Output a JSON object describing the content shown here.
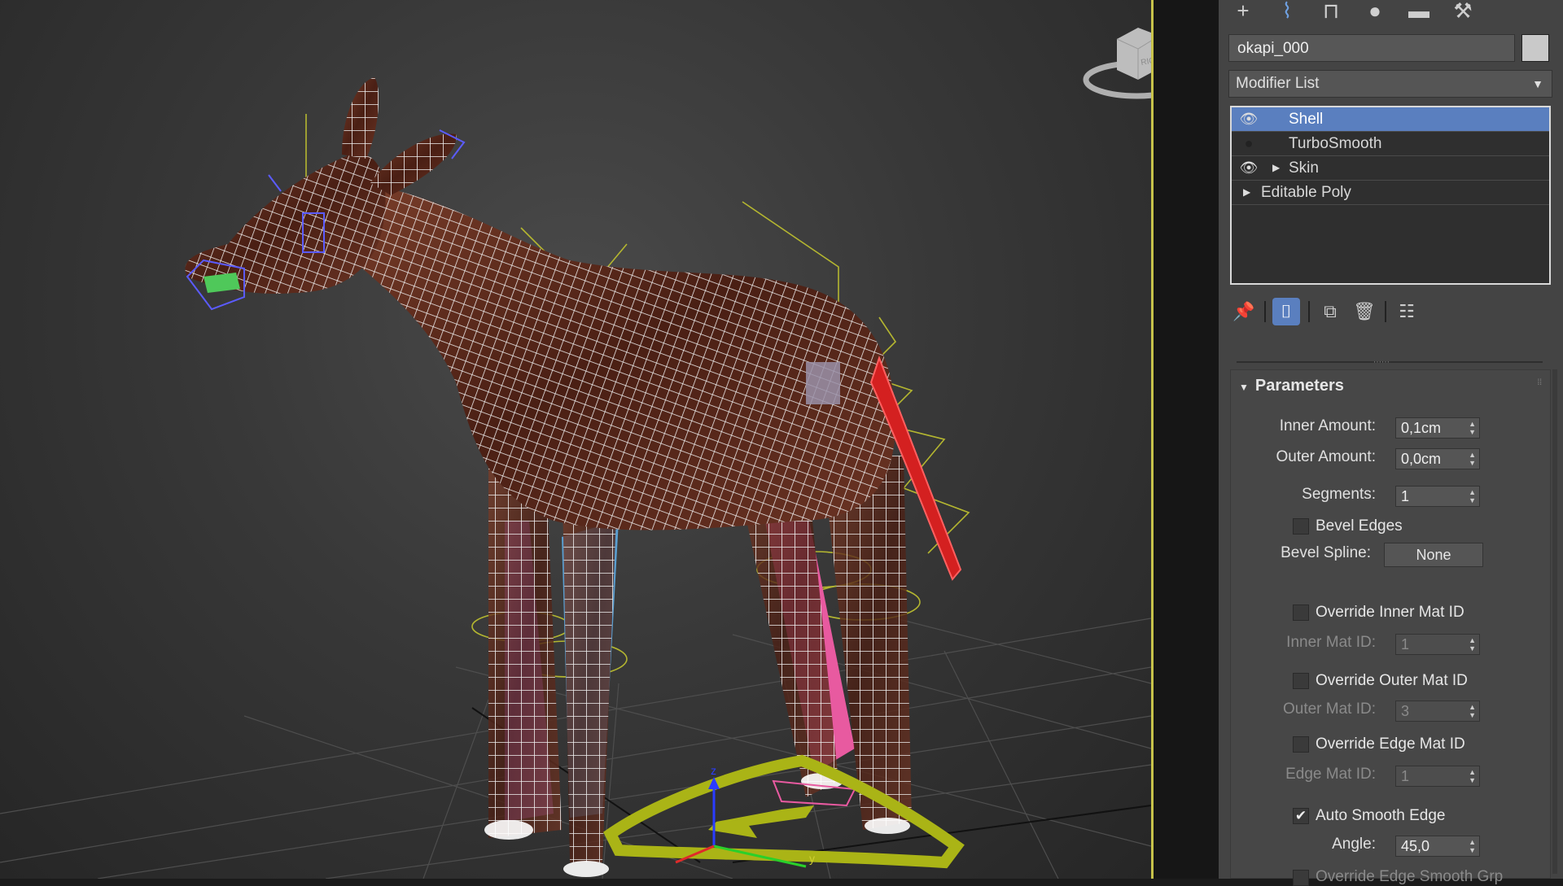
{
  "panel": {
    "top_icons": [
      "create-icon",
      "modify-icon",
      "hierarchy-icon",
      "motion-icon",
      "display-icon",
      "utilities-icon"
    ],
    "object_name": "okapi_000",
    "object_color": "#c9c9c9",
    "modifier_list_label": "Modifier List",
    "stack": [
      {
        "label": "Shell",
        "visible": true,
        "selected": true
      },
      {
        "label": "TurboSmooth",
        "visible": false,
        "selected": false
      },
      {
        "label": "Skin",
        "visible": true,
        "selected": false,
        "expandable": true
      },
      {
        "label": "Editable Poly",
        "base": true,
        "expandable": true
      }
    ],
    "rollout_title": "Parameters",
    "inner_amount_label": "Inner Amount:",
    "inner_amount_value": "0,1cm",
    "outer_amount_label": "Outer Amount:",
    "outer_amount_value": "0,0cm",
    "segments_label": "Segments:",
    "segments_value": "1",
    "bevel_edges_label": "Bevel Edges",
    "bevel_edges_checked": false,
    "bevel_spline_label": "Bevel Spline:",
    "bevel_spline_value": "None",
    "override_inner_label": "Override Inner Mat ID",
    "inner_mat_label": "Inner Mat ID:",
    "inner_mat_value": "1",
    "override_outer_label": "Override Outer Mat ID",
    "outer_mat_label": "Outer Mat ID:",
    "outer_mat_value": "3",
    "override_edge_label": "Override Edge Mat ID",
    "edge_mat_label": "Edge Mat ID:",
    "edge_mat_value": "1",
    "auto_smooth_label": "Auto Smooth Edge",
    "auto_smooth_checked": true,
    "angle_label": "Angle:",
    "angle_value": "45,0",
    "override_edge_smooth_label": "Override Edge Smooth Grp"
  },
  "viewport": {
    "viewcube_label": "RIGHT",
    "gizmo_axis_z": "z",
    "gizmo_axis_y": "y",
    "wire_color": "#ffffff",
    "body_color": "#5a2a1c",
    "border_color": "#c7c24a"
  }
}
